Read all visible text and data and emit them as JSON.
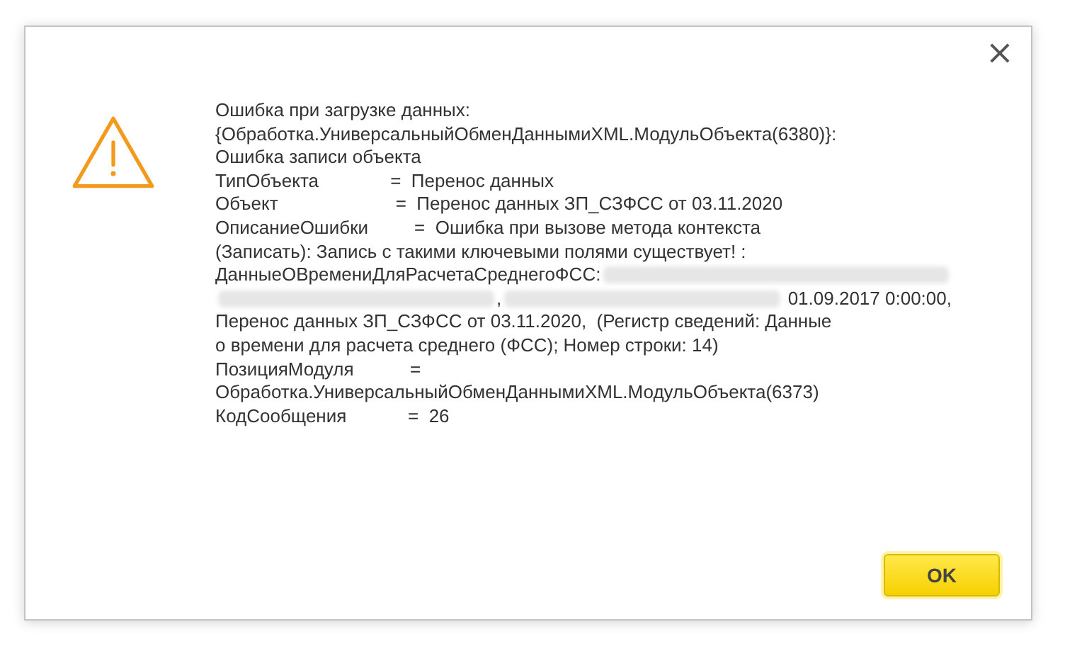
{
  "dialog": {
    "close": "×",
    "message": [
      {
        "text": "Ошибка при загрузке данных:"
      },
      {
        "text": "{Обработка.УниверсальныйОбменДаннымиXML.МодульОбъекта(6380)}:"
      },
      {
        "text": "Ошибка записи объекта"
      },
      {
        "text": "ТипОбъекта              =  Перенос данных"
      },
      {
        "text": "Объект                       =  Перенос данных ЗП_СЗФСС от 03.11.2020"
      },
      {
        "text": "ОписаниеОшибки         =  Ошибка при вызове метода контекста"
      },
      {
        "text": "(Записать): Запись с такими ключевыми полями существует! :"
      },
      {
        "parts": [
          {
            "kind": "text",
            "text": "ДанныеОВремениДляРасчетаСреднегоФСС:"
          },
          {
            "kind": "redacted"
          }
        ]
      },
      {
        "parts": [
          {
            "kind": "redacted"
          },
          {
            "kind": "text",
            "text": ","
          },
          {
            "kind": "redacted"
          },
          {
            "kind": "text",
            "text": " 01.09.2017 0:00:00,"
          }
        ]
      },
      {
        "text": "Перенос данных ЗП_СЗФСС от 03.11.2020,  (Регистр сведений: Данные"
      },
      {
        "text": "о времени для расчета среднего (ФСС); Номер строки: 14)"
      },
      {
        "text": "ПозицияМодуля           ="
      },
      {
        "text": "Обработка.УниверсальныйОбменДаннымиXML.МодульОбъекта(6373)"
      },
      {
        "text": "КодСообщения            =  26"
      }
    ],
    "buttons": [
      {
        "label": "OK",
        "default": true
      }
    ]
  }
}
